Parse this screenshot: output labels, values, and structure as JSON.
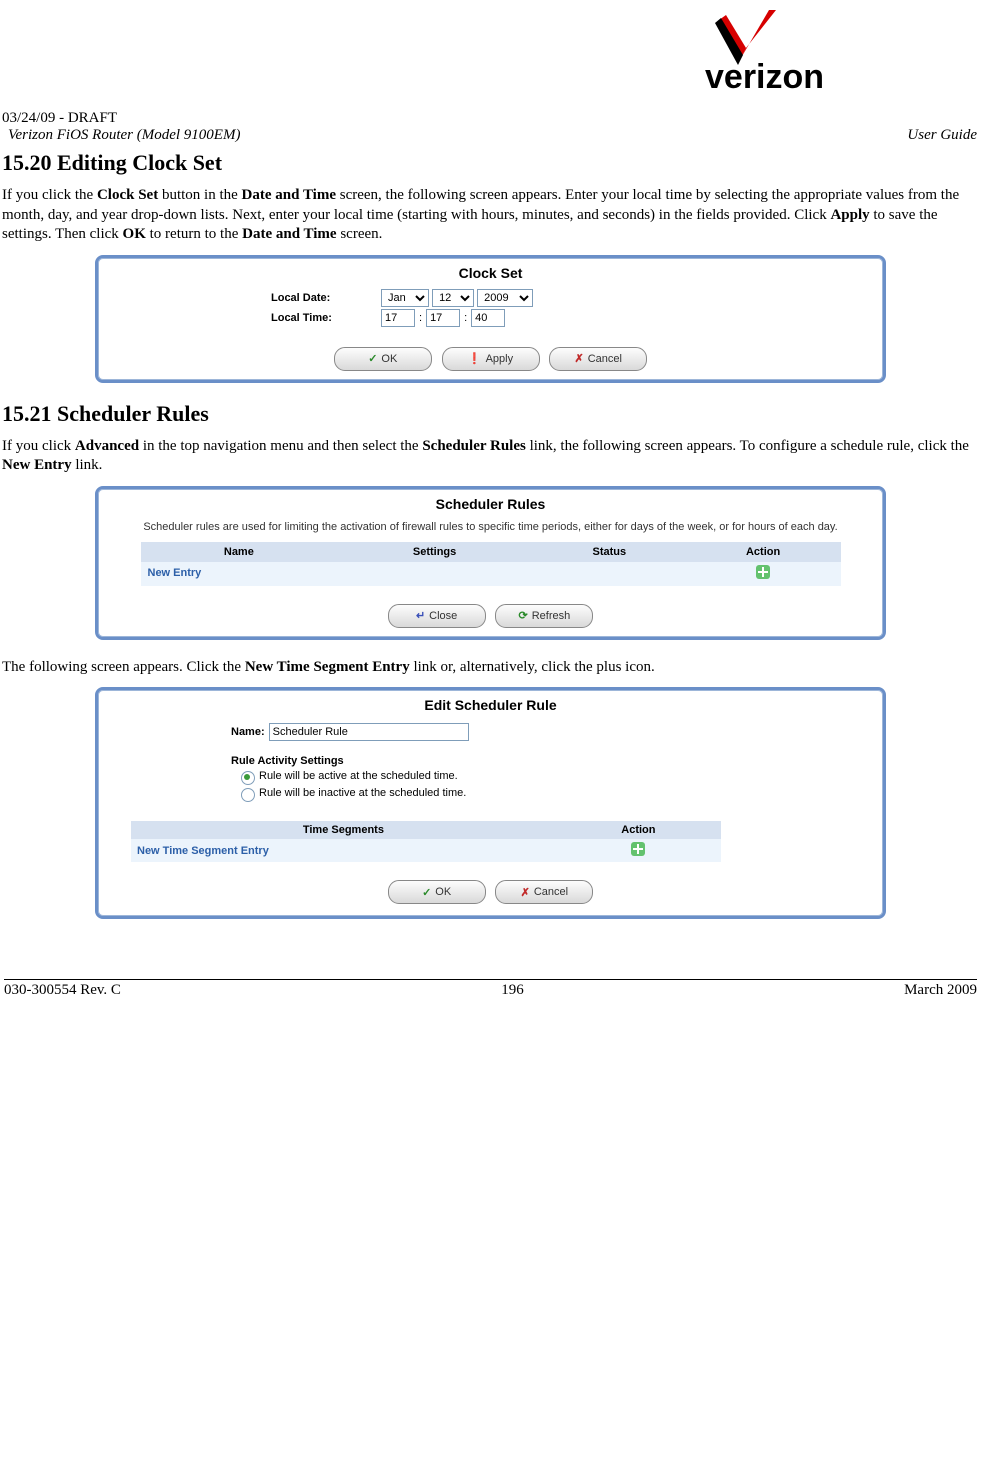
{
  "header": {
    "draft": "03/24/09 - DRAFT",
    "model": "Verizon FiOS Router (Model 9100EM)",
    "doc_type": "User Guide",
    "logo_text": "verizon"
  },
  "section1": {
    "heading": "15.20 Editing Clock Set",
    "para_pre": "If you click the ",
    "para_b1": "Clock Set",
    "para_mid1": " button in the ",
    "para_b2": "Date and Time",
    "para_mid2": " screen, the following screen appears. Enter your local time by selecting the appropriate values from the month, day, and year drop-down lists. Next, enter your local time (starting with hours, minutes, and seconds) in the fields provided. Click ",
    "para_b3": "Apply",
    "para_mid3": " to save the settings. Then click ",
    "para_b4": "OK",
    "para_mid4": " to return to the ",
    "para_b5": "Date and Time",
    "para_end": " screen."
  },
  "clock_panel": {
    "title": "Clock Set",
    "local_date_label": "Local Date:",
    "local_time_label": "Local Time:",
    "month": "Jan",
    "day": "12",
    "year": "2009",
    "hh": "17",
    "mm": "17",
    "ss": "40",
    "sep": ":",
    "btn_ok": "OK",
    "btn_apply": "Apply",
    "btn_cancel": "Cancel"
  },
  "section2": {
    "heading": "15.21   Scheduler Rules",
    "para_pre": "If you click ",
    "para_b1": "Advanced",
    "para_mid1": " in the top navigation menu and then select the ",
    "para_b2": "Scheduler Rules",
    "para_mid2": " link, the following screen appears. To configure a schedule rule, click the ",
    "para_b3": "New Entry",
    "para_end": " link."
  },
  "sched_panel": {
    "title": "Scheduler Rules",
    "desc": "Scheduler rules are used for limiting the activation of firewall rules to specific time periods, either for days of the week, or for hours of each day.",
    "col_name": "Name",
    "col_settings": "Settings",
    "col_status": "Status",
    "col_action": "Action",
    "new_entry": "New Entry",
    "btn_close": "Close",
    "btn_refresh": "Refresh"
  },
  "mid_para": {
    "pre": "The following screen appears. Click the ",
    "b1": "New Time Segment Entry",
    "end": " link or, alternatively, click the plus icon."
  },
  "edit_panel": {
    "title": "Edit Scheduler Rule",
    "name_label": "Name:",
    "name_value": "Scheduler Rule",
    "activity_heading": "Rule Activity Settings",
    "radio_active": "Rule will be active at the scheduled time.",
    "radio_inactive": "Rule will be inactive at the scheduled time.",
    "col_segments": "Time Segments",
    "col_action": "Action",
    "new_segment": "New Time Segment Entry",
    "btn_ok": "OK",
    "btn_cancel": "Cancel"
  },
  "footer": {
    "left": "030-300554 Rev. C",
    "mid": "196",
    "right": "March 2009"
  }
}
